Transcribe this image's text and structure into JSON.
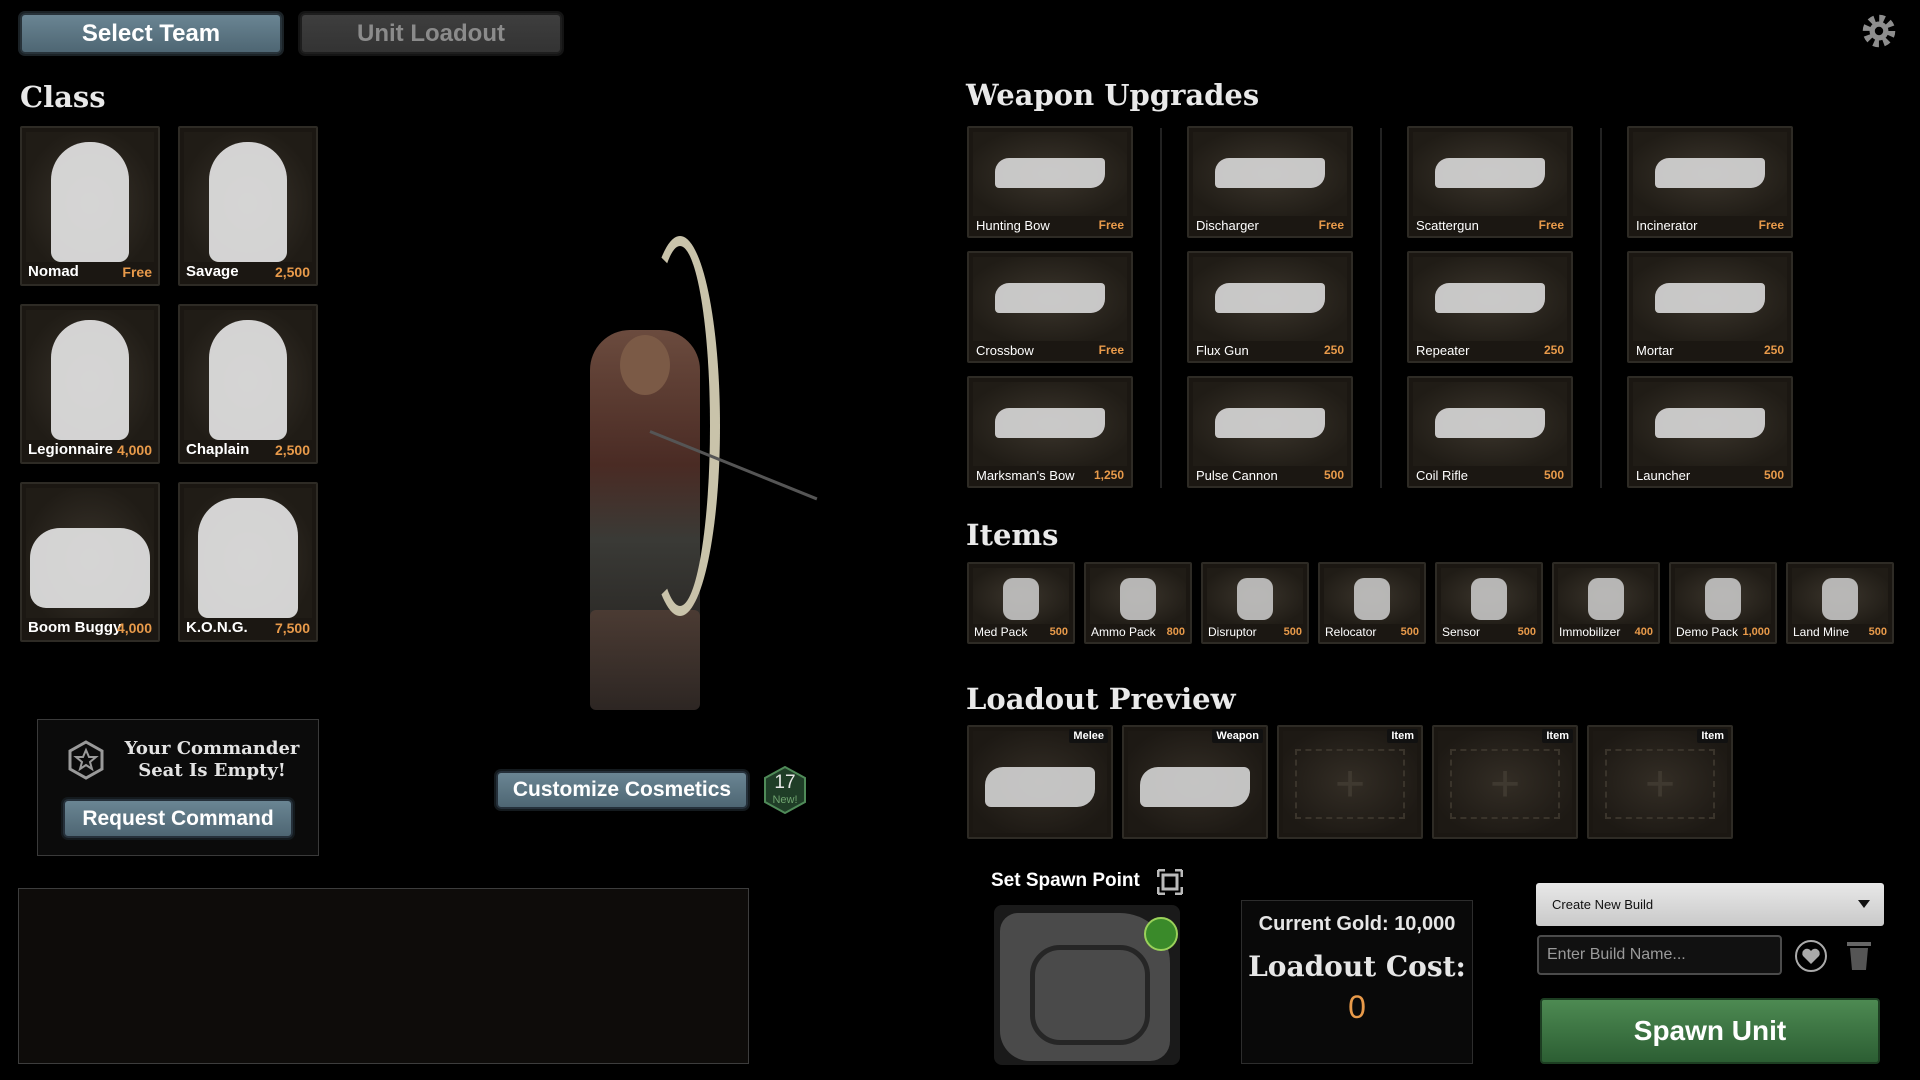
{
  "tabs": {
    "select_team": "Select Team",
    "unit_loadout": "Unit Loadout"
  },
  "settings_icon": "gear-icon",
  "class_section": {
    "title": "Class",
    "classes": [
      {
        "name": "Nomad",
        "price": "Free"
      },
      {
        "name": "Savage",
        "price": "2,500"
      },
      {
        "name": "Legionnaire",
        "price": "4,000"
      },
      {
        "name": "Chaplain",
        "price": "2,500"
      },
      {
        "name": "Boom Buggy",
        "price": "4,000"
      },
      {
        "name": "K.O.N.G.",
        "price": "7,500"
      }
    ]
  },
  "commander": {
    "text_line1": "Your Commander",
    "text_line2": "Seat Is Empty!",
    "request_button": "Request Command",
    "icon": "star-badge-icon"
  },
  "cosmetics": {
    "button": "Customize Cosmetics",
    "badge_count": "17",
    "badge_label": "New!"
  },
  "weapons": {
    "title": "Weapon Upgrades",
    "items": [
      {
        "name": "Hunting Bow",
        "price": "Free"
      },
      {
        "name": "Discharger",
        "price": "Free"
      },
      {
        "name": "Scattergun",
        "price": "Free"
      },
      {
        "name": "Incinerator",
        "price": "Free"
      },
      {
        "name": "Crossbow",
        "price": "Free"
      },
      {
        "name": "Flux Gun",
        "price": "250"
      },
      {
        "name": "Repeater",
        "price": "250"
      },
      {
        "name": "Mortar",
        "price": "250"
      },
      {
        "name": "Marksman's Bow",
        "price": "1,250"
      },
      {
        "name": "Pulse Cannon",
        "price": "500"
      },
      {
        "name": "Coil Rifle",
        "price": "500"
      },
      {
        "name": "Launcher",
        "price": "500"
      }
    ]
  },
  "items": {
    "title": "Items",
    "list": [
      {
        "name": "Med Pack",
        "price": "500"
      },
      {
        "name": "Ammo Pack",
        "price": "800"
      },
      {
        "name": "Disruptor",
        "price": "500"
      },
      {
        "name": "Relocator",
        "price": "500"
      },
      {
        "name": "Sensor",
        "price": "500"
      },
      {
        "name": "Immobilizer",
        "price": "400"
      },
      {
        "name": "Demo Pack",
        "price": "1,000"
      },
      {
        "name": "Land Mine",
        "price": "500"
      }
    ]
  },
  "loadout_preview": {
    "title": "Loadout Preview",
    "slots": [
      {
        "label": "Melee"
      },
      {
        "label": "Weapon"
      },
      {
        "label": "Item",
        "plus": "+"
      },
      {
        "label": "Item",
        "plus": "+"
      },
      {
        "label": "Item",
        "plus": "+"
      }
    ]
  },
  "spawn": {
    "label": "Set Spawn Point",
    "icon": "expand-map-icon"
  },
  "gold": {
    "current": "Current Gold: 10,000",
    "cost_label": "Loadout Cost:",
    "cost_value": "0"
  },
  "build": {
    "select_value": "Create New Build",
    "name_placeholder": "Enter Build Name...",
    "favorite_icon": "heart-icon",
    "delete_icon": "trash-icon"
  },
  "spawn_button": "Spawn Unit",
  "colors": {
    "price": "#e89a4a",
    "accent_blue": "#5a7482",
    "spawn_green": "#3b7542"
  }
}
